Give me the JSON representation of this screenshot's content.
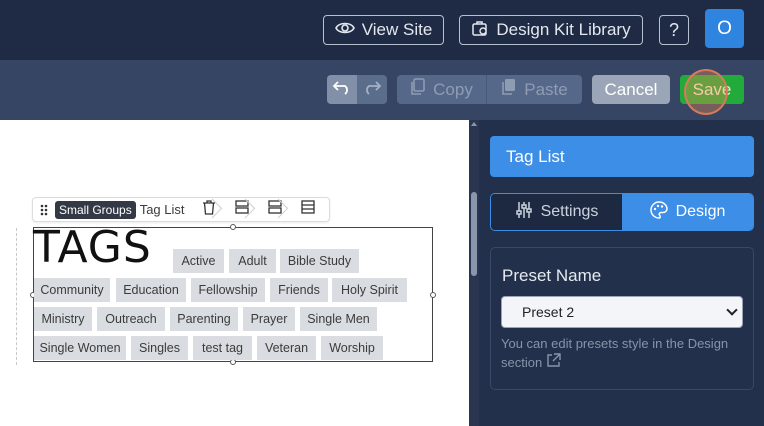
{
  "topbar": {
    "view_site": "View Site",
    "design_kit_library": "Design Kit Library",
    "help": "?",
    "avatar_initial": "O"
  },
  "actions": {
    "copy": "Copy",
    "paste": "Paste",
    "cancel": "Cancel",
    "save": "Save"
  },
  "toolbar": {
    "badge": "Small Groups",
    "label": "Tag List"
  },
  "widget": {
    "title": "TAGS",
    "tags": [
      "Active",
      "Adult",
      "Bible Study",
      "Community",
      "Education",
      "Fellowship",
      "Friends",
      "Holy Spirit",
      "Ministry",
      "Outreach",
      "Parenting",
      "Prayer",
      "Single Men",
      "Single Women",
      "Singles",
      "test tag",
      "Veteran",
      "Worship"
    ]
  },
  "panel": {
    "title": "Tag List",
    "tab_settings": "Settings",
    "tab_design": "Design",
    "preset_label": "Preset Name",
    "preset_value": "Preset 2",
    "hint": "You can edit presets style in the Design section"
  },
  "colors": {
    "topbar_bg": "#1f2b44",
    "actionbar_bg": "#364564",
    "accent": "#3d8ee6",
    "save": "#22aa3a"
  },
  "icons": [
    "eye-icon",
    "design-kit-icon",
    "undo-icon",
    "redo-icon",
    "copy-icon",
    "paste-icon",
    "drag-handle-icon",
    "trash-icon",
    "layout-icon",
    "sliders-icon",
    "palette-icon",
    "external-link-icon"
  ]
}
